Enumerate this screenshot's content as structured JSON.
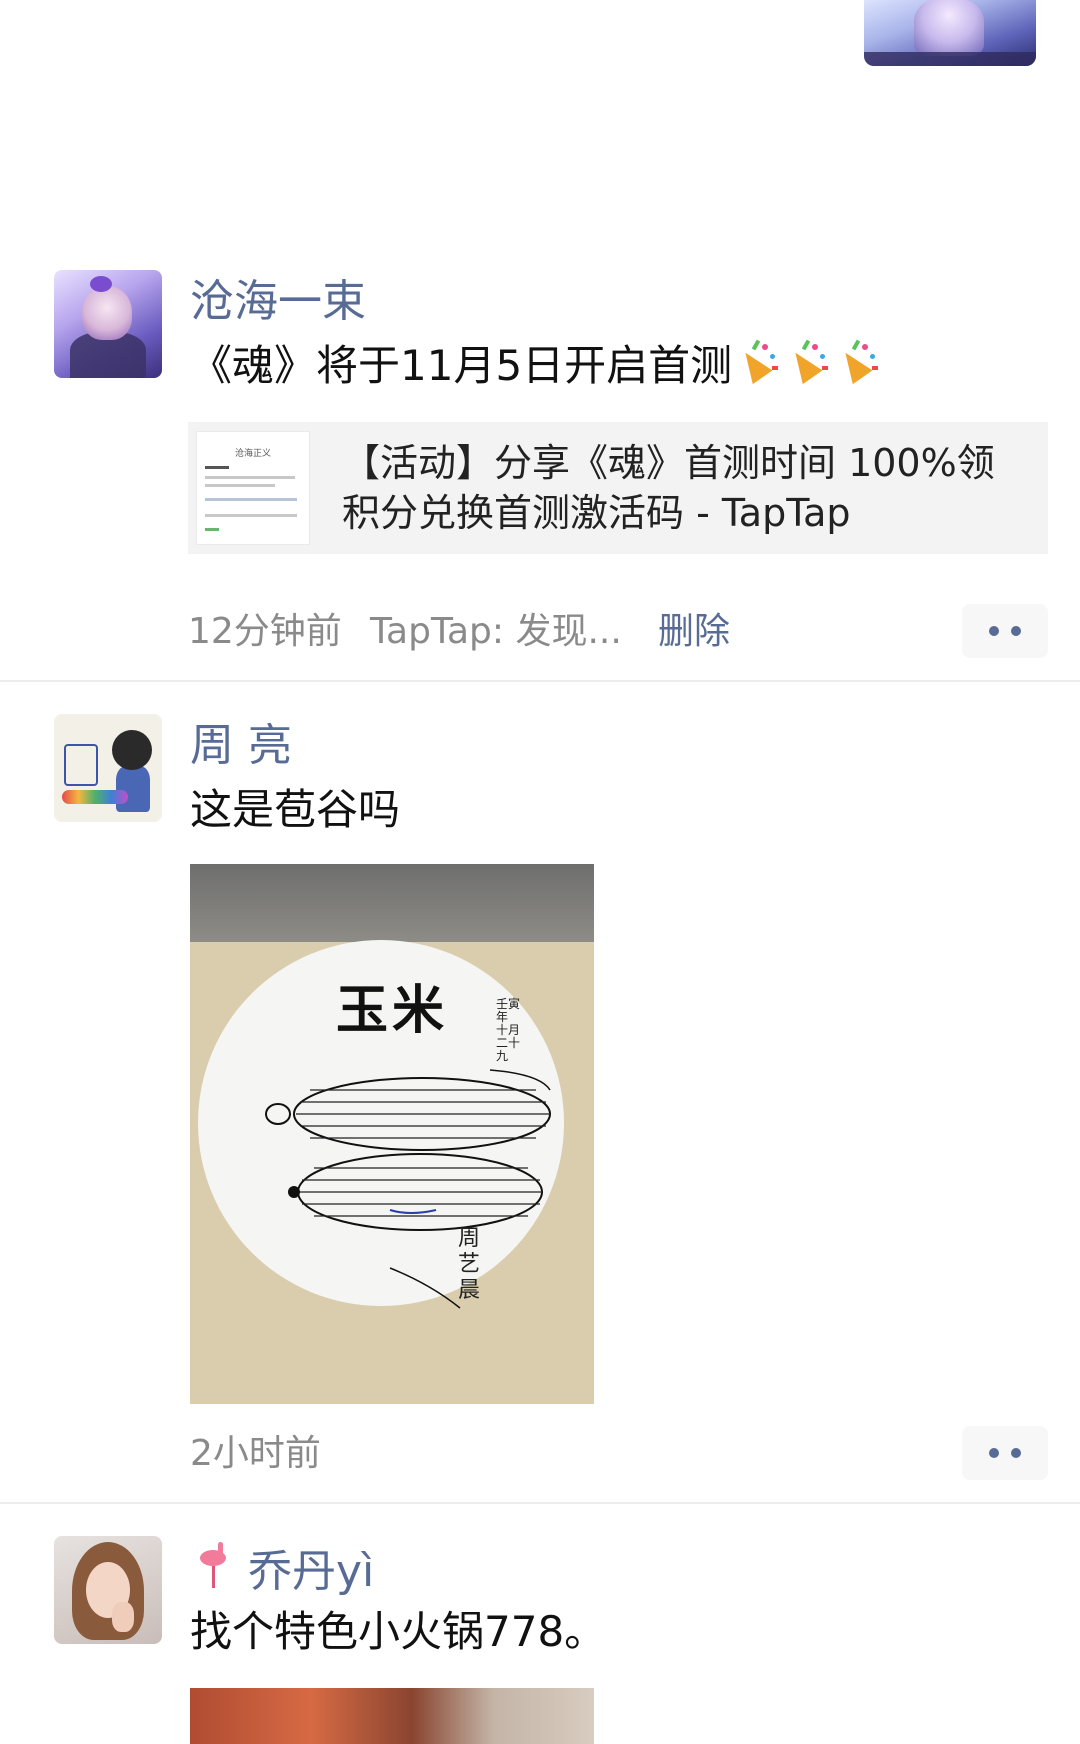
{
  "posts": [
    {
      "author": "沧海一束",
      "text": "《魂》将于11月5日开启首测",
      "emoji_icon": "party-popper-icon",
      "link": {
        "title": "【活动】分享《魂》首测时间 100%领积分兑换首测激活码 - TapTap",
        "thumb_title": "沧海正义"
      },
      "time": "12分钟前",
      "source": "TapTap: 发现...",
      "delete_label": "删除"
    },
    {
      "author": "周 亮",
      "text": "这是苞谷吗",
      "photo": {
        "title": "玉米",
        "note": "壬寅年 十月二十九",
        "signature": "周艺晨"
      },
      "time": "2小时前"
    },
    {
      "author": "乔丹yì",
      "author_icon": "flamingo-icon",
      "text": "找个特色小火锅778。"
    }
  ],
  "colors": {
    "name_blue": "#576b95",
    "divider": "#ececec",
    "card_bg": "#f3f3f3"
  }
}
